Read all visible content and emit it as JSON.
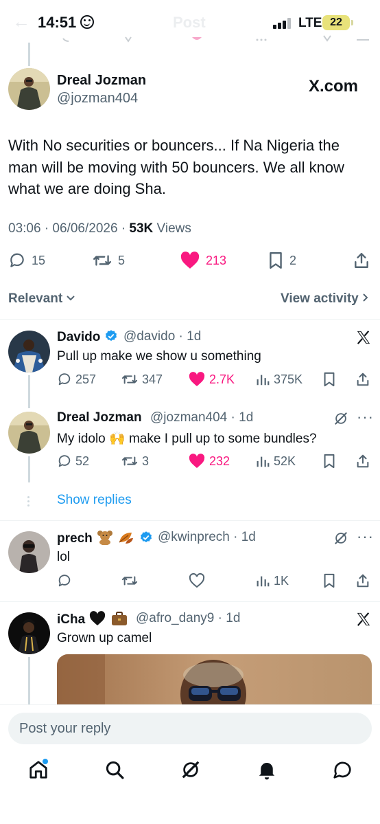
{
  "status_bar": {
    "time": "14:51",
    "network": "LTE",
    "battery": "22",
    "ghost_title": "Post"
  },
  "main_post": {
    "name": "Dreal Jozman",
    "handle": "@jozman404",
    "source_badge": "X.com",
    "text": "With No securities or bouncers... If Na Nigeria the man will be moving with 50 bouncers. We all know what we are doing Sha.",
    "timestamp": "03:06 · 06/06/2026 · ",
    "views_count": "53K",
    "views_label": " Views",
    "metrics": {
      "replies": "15",
      "reposts": "5",
      "likes": "213",
      "bookmarks": "2"
    }
  },
  "filter": {
    "sort_label": "Relevant",
    "view_activity": "View activity"
  },
  "replies": [
    {
      "name": "Davido",
      "handle": "@davido · 1d",
      "text": "Pull up make we show u something",
      "replies": "257",
      "reposts": "347",
      "likes": "2.7K",
      "views": "375K"
    },
    {
      "name": "Dreal Jozman",
      "handle": "@jozman404 · 1d",
      "text_before": "My idolo ",
      "emoji": "🙌",
      "text_after": " make I pull up to some bundles?",
      "replies": "52",
      "reposts": "3",
      "likes": "232",
      "views": "52K"
    },
    {
      "name": "prech",
      "handle": "@kwinprech · 1d",
      "text": "lol",
      "views": "1K"
    },
    {
      "name": "iCha",
      "handle": "@afro_dany9 · 1d",
      "text": "Grown up camel"
    }
  ],
  "show_replies": "Show replies",
  "reply_bar": {
    "placeholder": "Post your reply"
  },
  "tabs": [
    "home-icon",
    "search-icon",
    "grok-icon",
    "notifications-icon",
    "messages-icon"
  ],
  "colors": {
    "like_pink": "#f91880",
    "verified_blue": "#1d9bf0",
    "muted": "#536471"
  }
}
